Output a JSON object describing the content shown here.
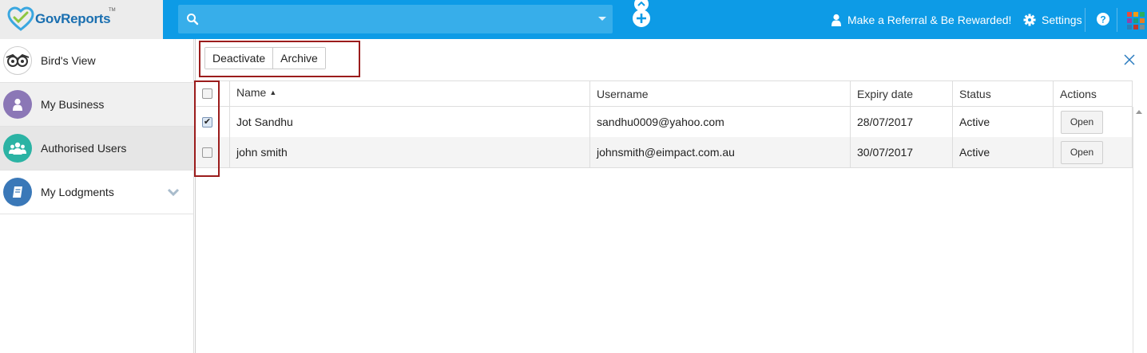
{
  "app": {
    "logo_text": "GovReports",
    "logo_tm": "TM"
  },
  "colors": {
    "topbar": "#0d9be6",
    "search_bg": "#37aeea",
    "highlight": "#9b1c1c"
  },
  "topbar": {
    "search_placeholder": "",
    "referral_label": "Make a Referral & Be Rewarded!",
    "settings_label": "Settings"
  },
  "sidebar": {
    "items": [
      {
        "label": "Bird's View",
        "icon": "owl-icon",
        "color": "#ffffff"
      },
      {
        "label": "My Business",
        "icon": "person-icon",
        "color": "#8b77b6"
      },
      {
        "label": "Authorised Users",
        "icon": "users-icon",
        "color": "#2bb3a4"
      },
      {
        "label": "My Lodgments",
        "icon": "book-icon",
        "color": "#3a78b8"
      }
    ]
  },
  "toolbar": {
    "deactivate_label": "Deactivate",
    "archive_label": "Archive"
  },
  "table": {
    "columns": [
      "Name",
      "Username",
      "Expiry date",
      "Status",
      "Actions"
    ],
    "sort_indicator": "▲",
    "rows": [
      {
        "checked": true,
        "name": "Jot Sandhu",
        "username": "sandhu0009@yahoo.com",
        "expiry": "28/07/2017",
        "status": "Active",
        "action": "Open"
      },
      {
        "checked": false,
        "name": "john smith",
        "username": "johnsmith@eimpact.com.au",
        "expiry": "30/07/2017",
        "status": "Active",
        "action": "Open"
      }
    ]
  }
}
